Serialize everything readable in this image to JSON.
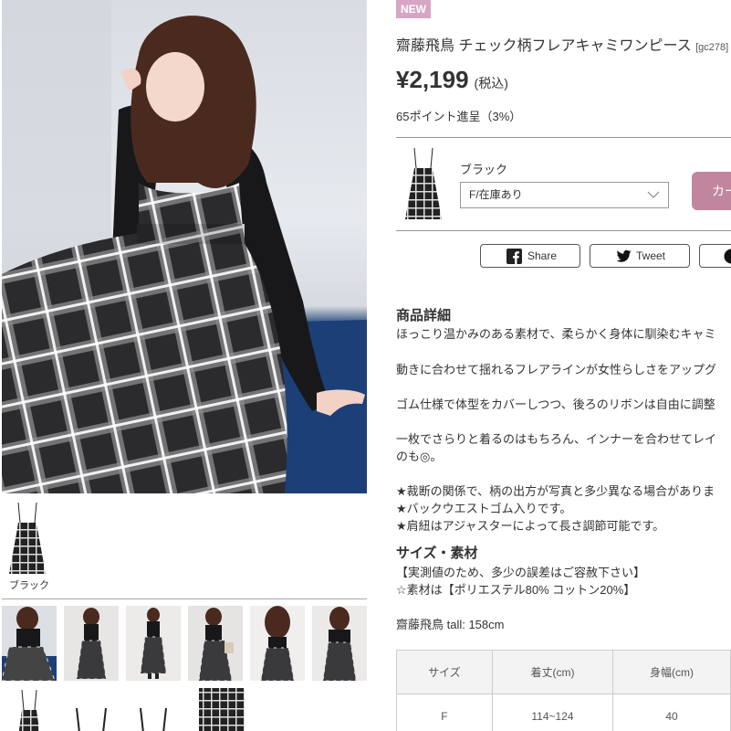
{
  "product": {
    "badge": "NEW",
    "name": "齋藤飛鳥 チェック柄フレアキャミワンピース",
    "code": "[gc278]",
    "price": "¥2,199",
    "tax_note": "(税込)",
    "points": "65ポイント進呈（3%）"
  },
  "gallery": {
    "swatch_label": "ブラック"
  },
  "purchase": {
    "color": "ブラック",
    "size_value": "F/在庫あり",
    "cart_label": "カート"
  },
  "share": {
    "facebook": "Share",
    "twitter": "Tweet"
  },
  "details": {
    "heading": "商品詳細",
    "lines": [
      "ほっこり温かみのある素材で、柔らかく身体に馴染むキャミ",
      "動きに合わせて揺れるフレアラインが女性らしさをアップグ",
      "ゴム仕様で体型をカバーしつつ、後ろのリボンは自由に調整",
      "一枚でさらりと着るのはもちろん、インナーを合わせてレイ",
      "のも◎。",
      "★裁断の関係で、柄の出方が写真と多少異なる場合がありま",
      "★バックウエストゴム入りです。",
      "★肩紐はアジャスターによって長さ調節可能です。"
    ]
  },
  "material": {
    "heading": "サイズ・素材",
    "lines": [
      "【実測値のため、多少の誤差はご容赦下さい】",
      "☆素材は【ポリエステル80% コットン20%】"
    ],
    "model": "齋藤飛鳥 tall: 158cm"
  },
  "size_table": {
    "headers": [
      "サイズ",
      "着丈(cm)",
      "身幅(cm)"
    ],
    "rows": [
      [
        "F",
        "114~124",
        "40"
      ]
    ]
  },
  "colors": {
    "accent": "#c0869e",
    "badge": "#d7a6c4",
    "floor": "#1d3f77"
  }
}
